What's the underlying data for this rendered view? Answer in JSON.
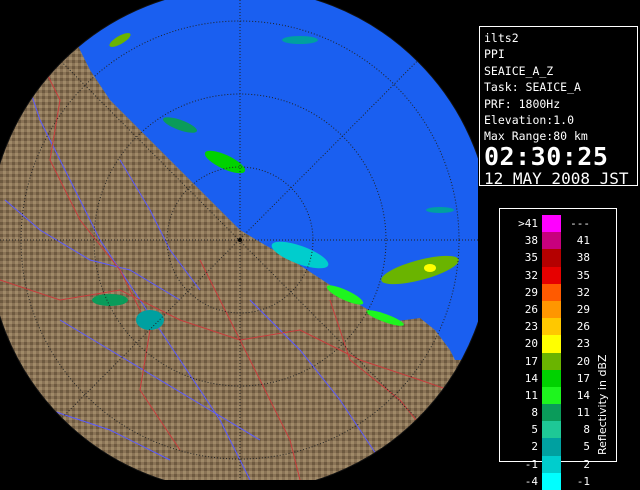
{
  "info": {
    "station": "ilts2",
    "product": "PPI",
    "scan_name": "SEAICE_A_Z",
    "task": "Task: SEAICE_A",
    "prf": "PRF: 1800Hz",
    "elevation": "Elevation:1.0",
    "max_range": "Max Range:80 km",
    "time": "02:30:25",
    "date": "12 MAY 2008 JST"
  },
  "legend": {
    "title": "Reflectivity in dBZ",
    "bins": [
      {
        "lo": ">41",
        "hi": "---",
        "color": "#ff00ff"
      },
      {
        "lo": "38",
        "hi": "41",
        "color": "#c8007d"
      },
      {
        "lo": "35",
        "hi": "38",
        "color": "#b40000"
      },
      {
        "lo": "32",
        "hi": "35",
        "color": "#e60000"
      },
      {
        "lo": "29",
        "hi": "32",
        "color": "#ff5a00"
      },
      {
        "lo": "26",
        "hi": "29",
        "color": "#ff9600"
      },
      {
        "lo": "23",
        "hi": "26",
        "color": "#ffc800"
      },
      {
        "lo": "20",
        "hi": "23",
        "color": "#ffff00"
      },
      {
        "lo": "17",
        "hi": "20",
        "color": "#6ab400"
      },
      {
        "lo": "14",
        "hi": "17",
        "color": "#00d200"
      },
      {
        "lo": "11",
        "hi": "14",
        "color": "#1ef51e"
      },
      {
        "lo": "8",
        "hi": "11",
        "color": "#0a9b5a"
      },
      {
        "lo": "5",
        "hi": "8",
        "color": "#1ec896"
      },
      {
        "lo": "2",
        "hi": "5",
        "color": "#00a0a0"
      },
      {
        "lo": "-1",
        "hi": "2",
        "color": "#00cdcd"
      },
      {
        "lo": "-4",
        "hi": "-1",
        "color": "#00ffff"
      }
    ]
  },
  "colors": {
    "sea": "#1a5ff0",
    "land": "#8a7356",
    "land_dark": "#5a4630",
    "range_ring": "#222222",
    "rivers": "#5a5aff",
    "borders": "#c83c3c"
  },
  "icons": {
    "radar_site": "radar-site-marker"
  }
}
